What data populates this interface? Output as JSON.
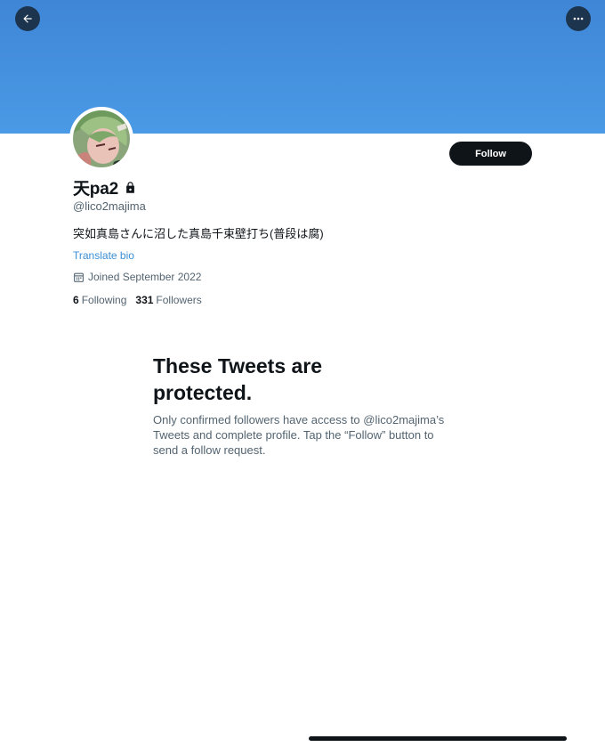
{
  "header": {
    "back_icon": "arrow-left-icon",
    "more_icon": "more-horizontal-icon",
    "banner_color": "#4a9ae6"
  },
  "profile": {
    "display_name": "天pa2",
    "protected_icon": "lock-icon",
    "handle": "@lico2majima",
    "bio": "突如真島さんに沼した真島千束壁打ち(普段は腐)",
    "translate_label": "Translate bio",
    "joined_icon": "calendar-icon",
    "joined": "Joined September 2022",
    "following_count": "6",
    "following_label": "Following",
    "followers_count": "331",
    "followers_label": "Followers",
    "follow_button": "Follow",
    "accent_color": "#3b8fd5"
  },
  "protected_notice": {
    "title": "These Tweets are protected.",
    "description": "Only confirmed followers have access to @lico2majima’s Tweets and complete profile. Tap the “Follow” button to send a follow request."
  }
}
